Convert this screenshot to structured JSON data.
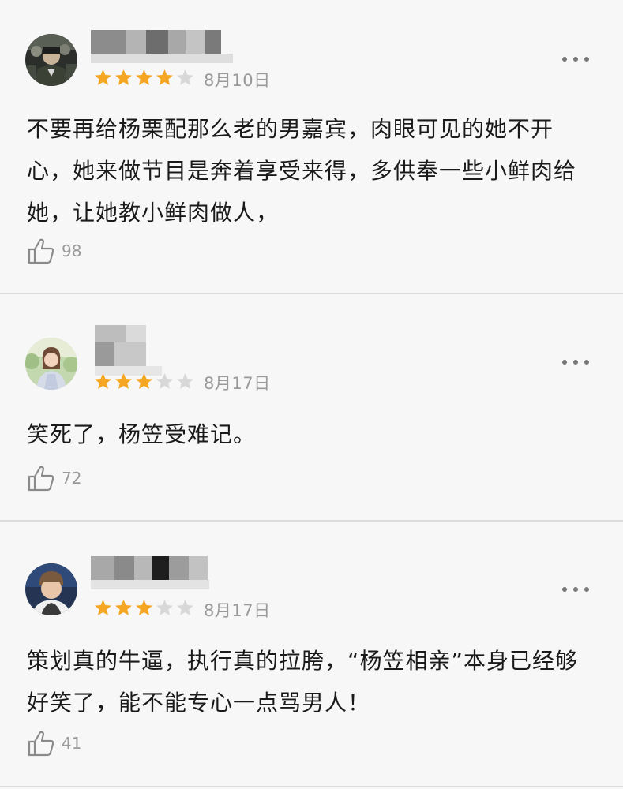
{
  "reviews": [
    {
      "username": "",
      "rating": 4,
      "max_rating": 5,
      "date": "8月10日",
      "content": "不要再给杨栗配那么老的男嘉宾，肉眼可见的她不开心，她来做节目是奔着享受来得，多供奉一些小鲜肉给她，让她教小鲜肉做人，",
      "likes": "98"
    },
    {
      "username": "",
      "rating": 3,
      "max_rating": 5,
      "date": "8月17日",
      "content": "笑死了，杨笠受难记。",
      "likes": "72"
    },
    {
      "username": "",
      "rating": 3,
      "max_rating": 5,
      "date": "8月17日",
      "content": "策划真的牛逼，执行真的拉胯，“杨笠相亲”本身已经够好笑了，能不能专心一点骂男人！",
      "likes": "41"
    }
  ],
  "colors": {
    "star_filled": "#f5a623",
    "star_empty": "#d8d8d8",
    "background": "#f7f7f7",
    "divider": "#dcdcdc"
  },
  "icons": {
    "more": "more-dots-icon",
    "like": "thumbs-up-icon",
    "star": "star-icon"
  }
}
